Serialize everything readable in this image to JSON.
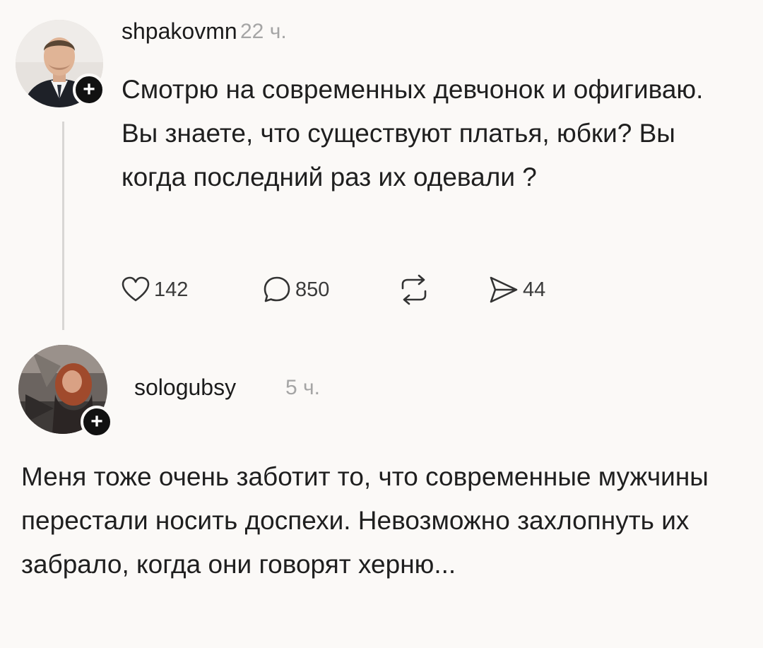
{
  "post": {
    "username": "shpakovmn",
    "time": "22 ч.",
    "text": "Смотрю на современных девчонок и офигиваю. Вы знаете, что существуют платья, юбки? Вы когда последний раз их одевали ?",
    "actions": {
      "likes": "142",
      "comments": "850",
      "shares": "44"
    },
    "icons": {
      "like": "heart-icon",
      "comment": "comment-bubble-icon",
      "repost": "repost-icon",
      "share": "send-icon",
      "follow": "plus-icon"
    }
  },
  "reply": {
    "username": "sologubsy",
    "time": "5 ч.",
    "text": "Меня тоже очень заботит то, что современные мужчины перестали носить доспехи. Невозможно захлопнуть их забрало, когда они говорят херню...",
    "icons": {
      "follow": "plus-icon"
    }
  },
  "colors": {
    "background": "#fbf9f7",
    "text": "#1c1c1c",
    "muted": "#a5a5a5",
    "badge": "#111111",
    "thread_line": "#d8d6d4"
  }
}
